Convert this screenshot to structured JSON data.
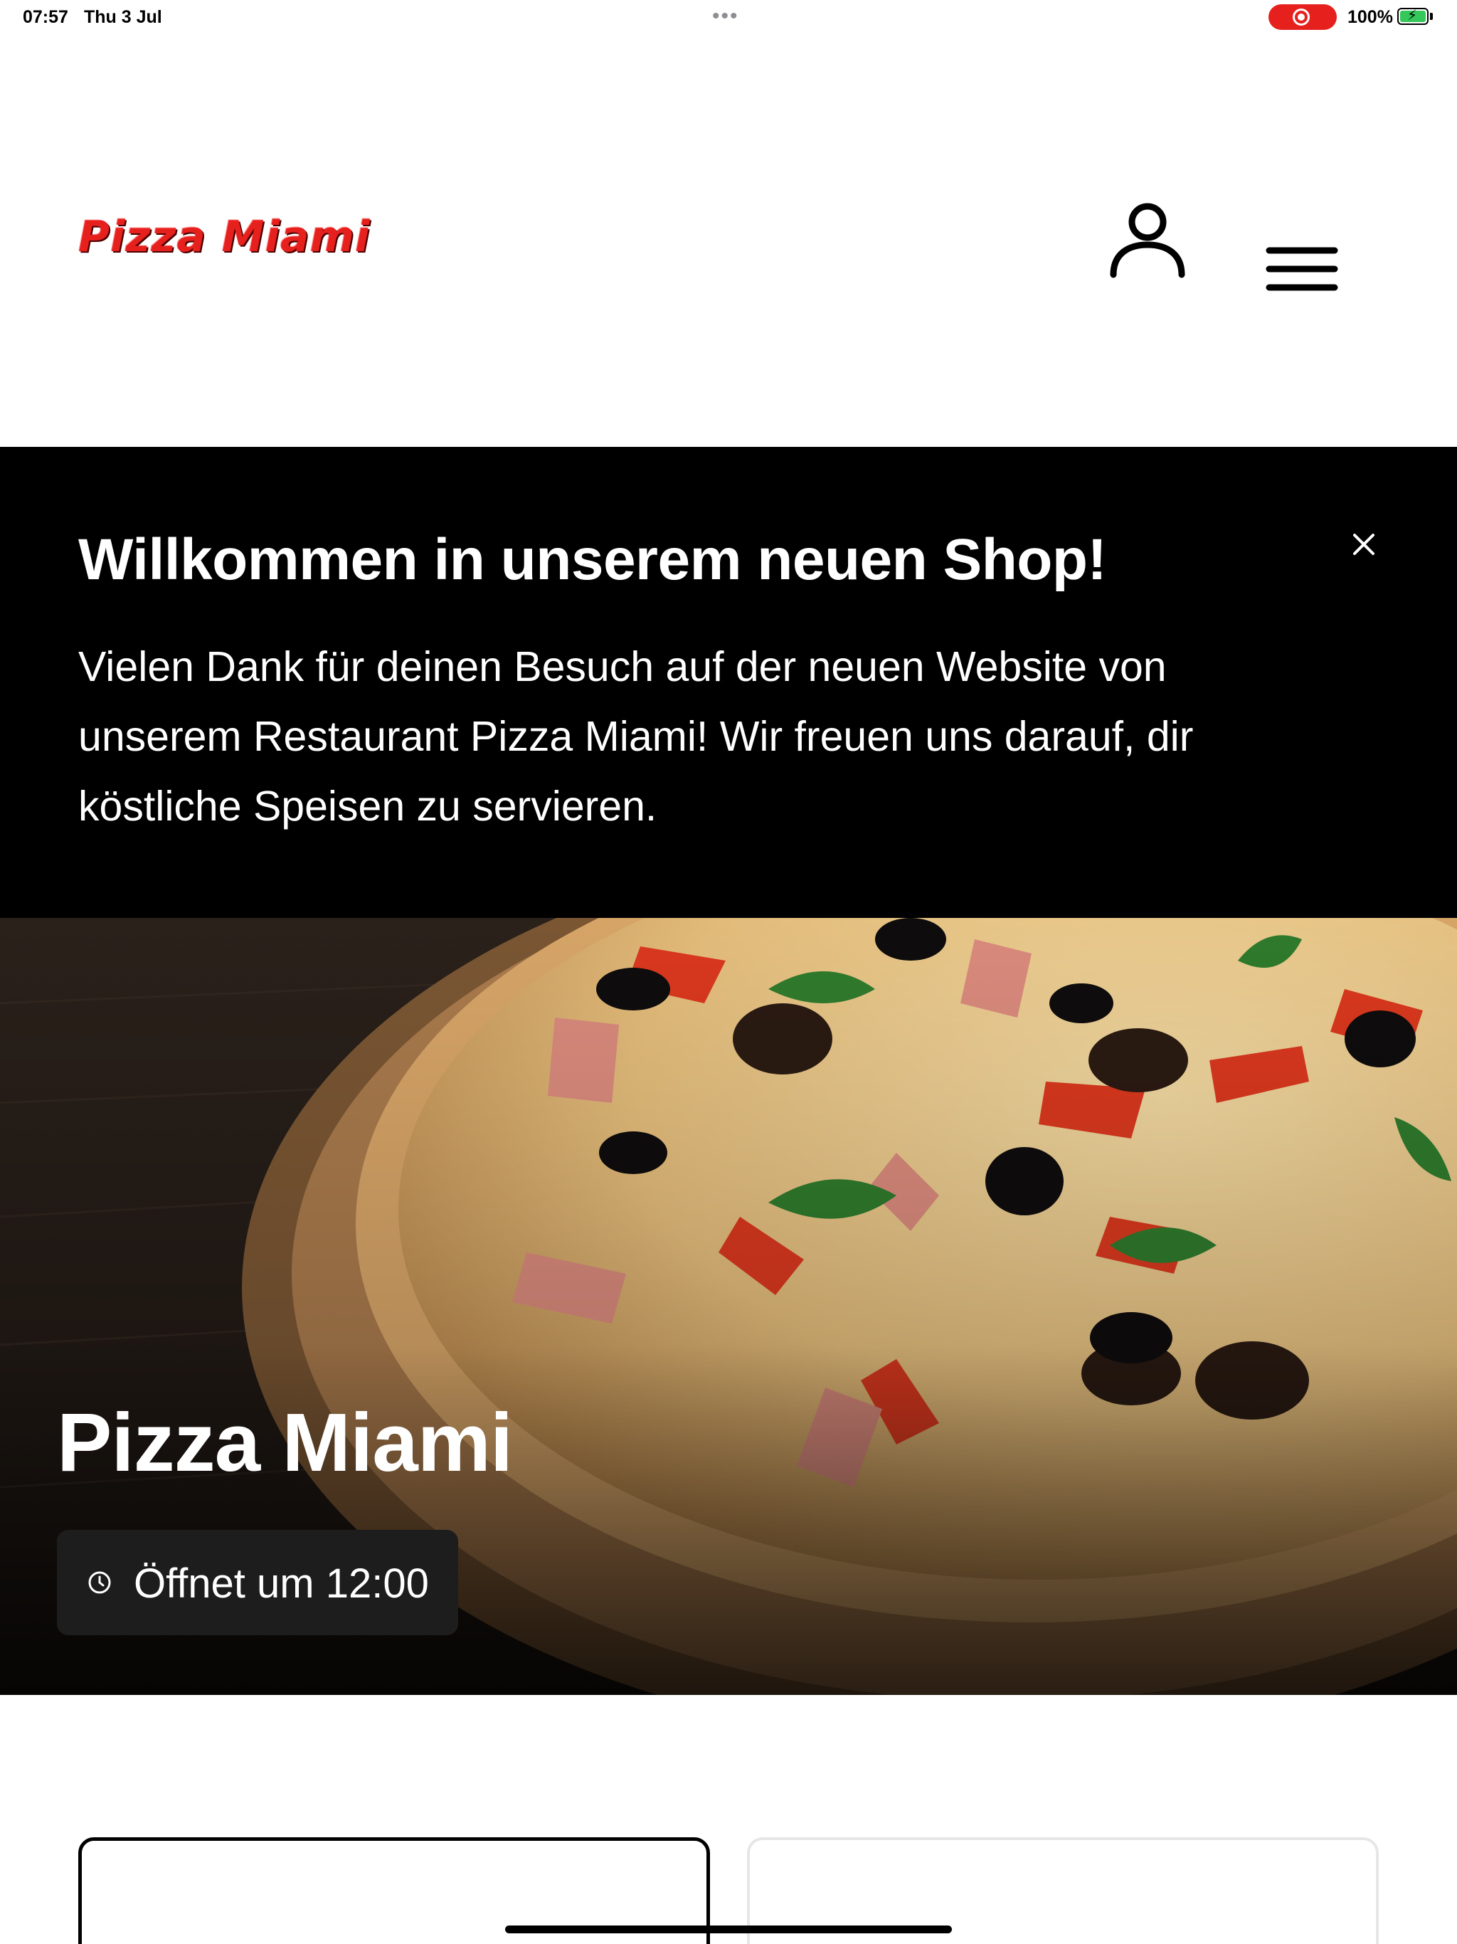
{
  "status_bar": {
    "time": "07:57",
    "date": "Thu 3 Jul",
    "dots": "•••",
    "battery": "100%",
    "battery_bolt": "⚡"
  },
  "header": {
    "logo_text": "Pizza Miami",
    "account_icon": "user-icon",
    "menu_icon": "hamburger-menu-icon"
  },
  "banner": {
    "title": "Willkommen in unserem neuen Shop!",
    "text": "Vielen Dank für deinen Besuch auf der neuen Website von unserem Restaurant Pizza Miami! Wir freuen uns darauf, dir köstliche Speisen zu servieren.",
    "close_icon": "close-icon"
  },
  "hero": {
    "title": "Pizza Miami",
    "hours_label": "Öffnet um 12:00",
    "hours_icon": "clock-icon"
  },
  "colors": {
    "brand_red": "#e5201d",
    "banner_bg": "#000000",
    "badge_bg": "#1d1d1d"
  }
}
